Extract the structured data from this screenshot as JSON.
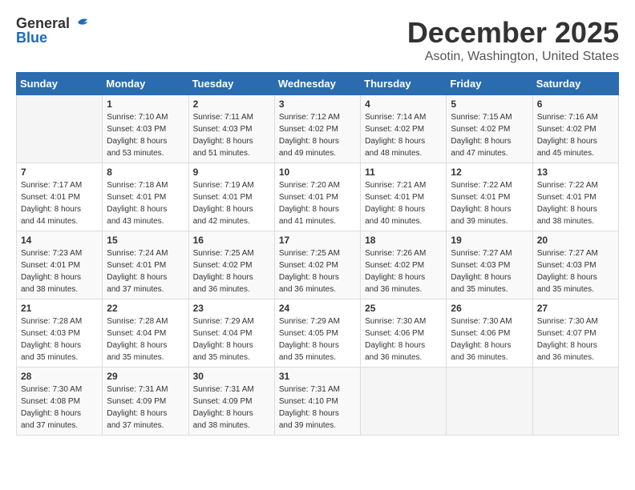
{
  "header": {
    "logo_general": "General",
    "logo_blue": "Blue",
    "title": "December 2025",
    "subtitle": "Asotin, Washington, United States"
  },
  "calendar": {
    "weekdays": [
      "Sunday",
      "Monday",
      "Tuesday",
      "Wednesday",
      "Thursday",
      "Friday",
      "Saturday"
    ],
    "weeks": [
      [
        {
          "day": "",
          "info": ""
        },
        {
          "day": "1",
          "info": "Sunrise: 7:10 AM\nSunset: 4:03 PM\nDaylight: 8 hours\nand 53 minutes."
        },
        {
          "day": "2",
          "info": "Sunrise: 7:11 AM\nSunset: 4:03 PM\nDaylight: 8 hours\nand 51 minutes."
        },
        {
          "day": "3",
          "info": "Sunrise: 7:12 AM\nSunset: 4:02 PM\nDaylight: 8 hours\nand 49 minutes."
        },
        {
          "day": "4",
          "info": "Sunrise: 7:14 AM\nSunset: 4:02 PM\nDaylight: 8 hours\nand 48 minutes."
        },
        {
          "day": "5",
          "info": "Sunrise: 7:15 AM\nSunset: 4:02 PM\nDaylight: 8 hours\nand 47 minutes."
        },
        {
          "day": "6",
          "info": "Sunrise: 7:16 AM\nSunset: 4:02 PM\nDaylight: 8 hours\nand 45 minutes."
        }
      ],
      [
        {
          "day": "7",
          "info": "Sunrise: 7:17 AM\nSunset: 4:01 PM\nDaylight: 8 hours\nand 44 minutes."
        },
        {
          "day": "8",
          "info": "Sunrise: 7:18 AM\nSunset: 4:01 PM\nDaylight: 8 hours\nand 43 minutes."
        },
        {
          "day": "9",
          "info": "Sunrise: 7:19 AM\nSunset: 4:01 PM\nDaylight: 8 hours\nand 42 minutes."
        },
        {
          "day": "10",
          "info": "Sunrise: 7:20 AM\nSunset: 4:01 PM\nDaylight: 8 hours\nand 41 minutes."
        },
        {
          "day": "11",
          "info": "Sunrise: 7:21 AM\nSunset: 4:01 PM\nDaylight: 8 hours\nand 40 minutes."
        },
        {
          "day": "12",
          "info": "Sunrise: 7:22 AM\nSunset: 4:01 PM\nDaylight: 8 hours\nand 39 minutes."
        },
        {
          "day": "13",
          "info": "Sunrise: 7:22 AM\nSunset: 4:01 PM\nDaylight: 8 hours\nand 38 minutes."
        }
      ],
      [
        {
          "day": "14",
          "info": "Sunrise: 7:23 AM\nSunset: 4:01 PM\nDaylight: 8 hours\nand 38 minutes."
        },
        {
          "day": "15",
          "info": "Sunrise: 7:24 AM\nSunset: 4:01 PM\nDaylight: 8 hours\nand 37 minutes."
        },
        {
          "day": "16",
          "info": "Sunrise: 7:25 AM\nSunset: 4:02 PM\nDaylight: 8 hours\nand 36 minutes."
        },
        {
          "day": "17",
          "info": "Sunrise: 7:25 AM\nSunset: 4:02 PM\nDaylight: 8 hours\nand 36 minutes."
        },
        {
          "day": "18",
          "info": "Sunrise: 7:26 AM\nSunset: 4:02 PM\nDaylight: 8 hours\nand 36 minutes."
        },
        {
          "day": "19",
          "info": "Sunrise: 7:27 AM\nSunset: 4:03 PM\nDaylight: 8 hours\nand 35 minutes."
        },
        {
          "day": "20",
          "info": "Sunrise: 7:27 AM\nSunset: 4:03 PM\nDaylight: 8 hours\nand 35 minutes."
        }
      ],
      [
        {
          "day": "21",
          "info": "Sunrise: 7:28 AM\nSunset: 4:03 PM\nDaylight: 8 hours\nand 35 minutes."
        },
        {
          "day": "22",
          "info": "Sunrise: 7:28 AM\nSunset: 4:04 PM\nDaylight: 8 hours\nand 35 minutes."
        },
        {
          "day": "23",
          "info": "Sunrise: 7:29 AM\nSunset: 4:04 PM\nDaylight: 8 hours\nand 35 minutes."
        },
        {
          "day": "24",
          "info": "Sunrise: 7:29 AM\nSunset: 4:05 PM\nDaylight: 8 hours\nand 35 minutes."
        },
        {
          "day": "25",
          "info": "Sunrise: 7:30 AM\nSunset: 4:06 PM\nDaylight: 8 hours\nand 36 minutes."
        },
        {
          "day": "26",
          "info": "Sunrise: 7:30 AM\nSunset: 4:06 PM\nDaylight: 8 hours\nand 36 minutes."
        },
        {
          "day": "27",
          "info": "Sunrise: 7:30 AM\nSunset: 4:07 PM\nDaylight: 8 hours\nand 36 minutes."
        }
      ],
      [
        {
          "day": "28",
          "info": "Sunrise: 7:30 AM\nSunset: 4:08 PM\nDaylight: 8 hours\nand 37 minutes."
        },
        {
          "day": "29",
          "info": "Sunrise: 7:31 AM\nSunset: 4:09 PM\nDaylight: 8 hours\nand 37 minutes."
        },
        {
          "day": "30",
          "info": "Sunrise: 7:31 AM\nSunset: 4:09 PM\nDaylight: 8 hours\nand 38 minutes."
        },
        {
          "day": "31",
          "info": "Sunrise: 7:31 AM\nSunset: 4:10 PM\nDaylight: 8 hours\nand 39 minutes."
        },
        {
          "day": "",
          "info": ""
        },
        {
          "day": "",
          "info": ""
        },
        {
          "day": "",
          "info": ""
        }
      ]
    ]
  }
}
